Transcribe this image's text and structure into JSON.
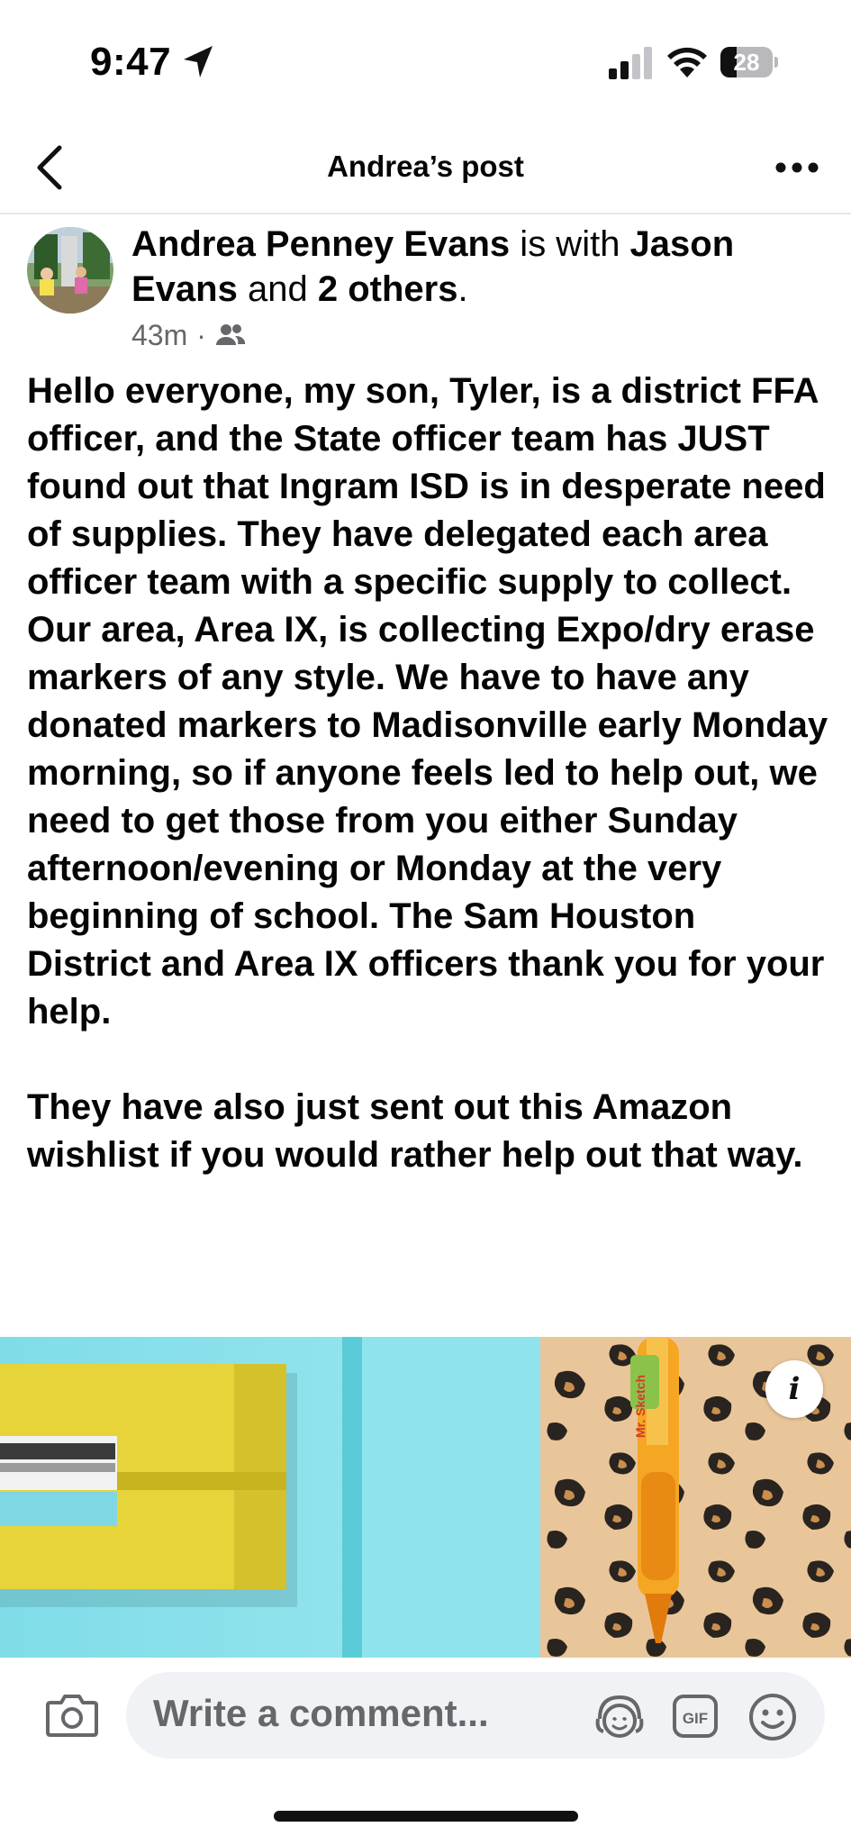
{
  "status_bar": {
    "time": "9:47",
    "battery_level": "28",
    "icons": [
      "location-arrow-icon",
      "cellular-signal-icon",
      "wifi-icon",
      "battery-icon"
    ]
  },
  "nav": {
    "title": "Andrea’s post",
    "icons": [
      "back-chevron-icon",
      "more-dots-icon"
    ]
  },
  "post": {
    "author": "Andrea Penney Evans",
    "with_text": " is with ",
    "tagged": "Jason Evans",
    "and_text": " and ",
    "others": "2 others",
    "period": ".",
    "time_ago": "43m",
    "separator": "·",
    "audience_icon": "friends-icon",
    "paragraphs": [
      "Hello everyone, my son, Tyler, is a district FFA officer, and the State officer team has JUST found out that Ingram ISD is in desperate need of supplies. They have delegated each area officer team with a specific supply to collect. Our area, Area IX, is collecting Expo/dry erase markers of any style. We have to have any donated markers to Madisonville early Monday morning, so if anyone feels led to help out, we need to get those from you either Sunday afternoon/evening or Monday at the very beginning of school. The Sam Houston District and Area IX officers thank you for your help.",
      "They have also just sent out this Amazon wishlist if you would rather help out that way."
    ]
  },
  "preview": {
    "info_label": "i",
    "pen_brand": "Mr. Sketch"
  },
  "comment_bar": {
    "placeholder": "Write a comment...",
    "gif_label": "GIF",
    "icons": [
      "camera-icon",
      "avatar-sticker-icon",
      "gif-icon",
      "emoji-icon"
    ]
  },
  "colors": {
    "text": "#050505",
    "secondary_text": "#65676b",
    "input_bg": "#f0f2f5",
    "divider": "#e4e6eb"
  }
}
